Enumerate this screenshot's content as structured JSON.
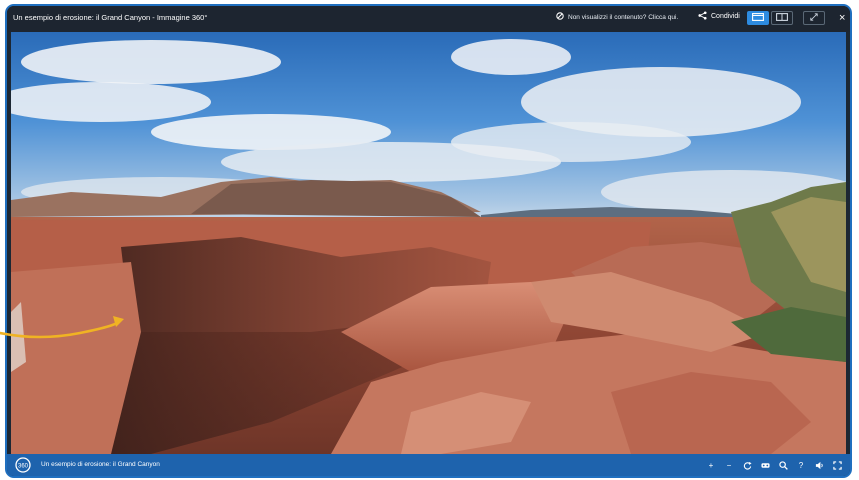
{
  "window": {
    "title": "Un esempio di erosione: il Grand Canyon - Immagine 360°"
  },
  "notice": {
    "label": "Non visualizzi il contenuto? Clicca qui."
  },
  "share": {
    "label": "Condividi"
  },
  "bottom": {
    "caption": "Un esempio di erosione: il Grand Canyon"
  },
  "icons": {
    "top": [
      "block-icon",
      "share-icon",
      "single-view-icon",
      "split-view-icon",
      "resize-icon",
      "close-icon"
    ],
    "bottom": [
      "zoom-in-icon",
      "zoom-out-icon",
      "rotate-icon",
      "vr-headset-icon",
      "search-icon",
      "help-icon",
      "sound-icon",
      "fullscreen-icon"
    ]
  },
  "controls": {
    "zoom_in": "+",
    "zoom_out": "−",
    "help": "?"
  },
  "colors": {
    "frame_border": "#1f6fbf",
    "topbar": "#1d2530",
    "bottombar": "#1e63ad",
    "active_button": "#2d8be0",
    "arrow": "#f0b323"
  }
}
